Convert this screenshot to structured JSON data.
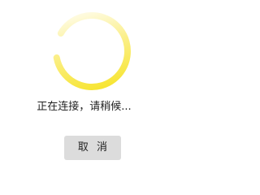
{
  "dialog": {
    "status_text": "正在连接，请稍候...",
    "cancel_label": "取 消"
  },
  "spinner": {
    "icon": "loading-spinner-icon",
    "color_head": "#f6e21a",
    "color_tail": "#ffffff"
  },
  "colors": {
    "background": "#ffffff",
    "button_bg": "#dcdcdc",
    "text": "#222222"
  }
}
